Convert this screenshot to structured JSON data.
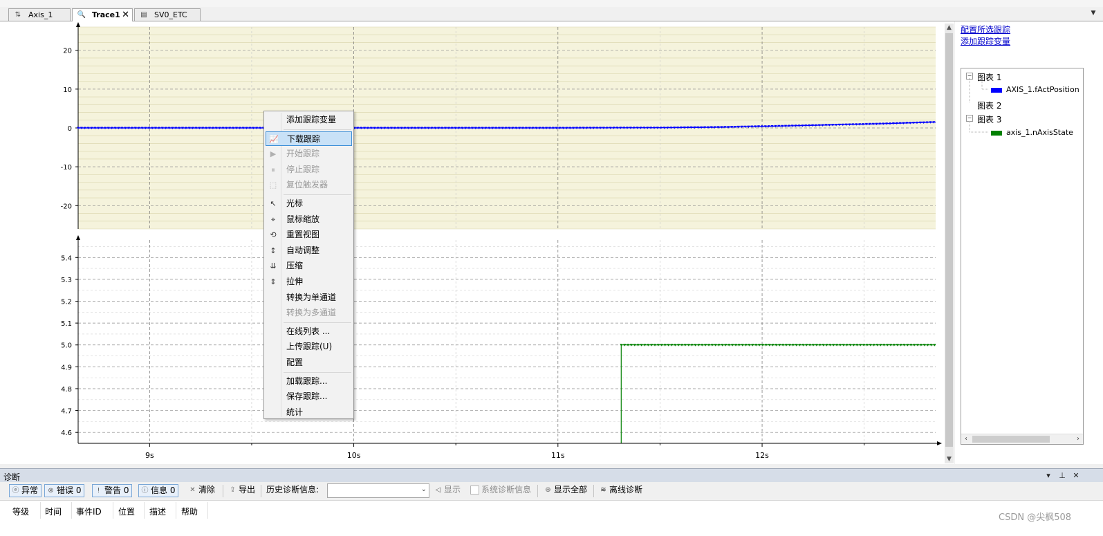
{
  "tabs": [
    {
      "label": "Axis_1",
      "icon": "axis-icon",
      "active": false
    },
    {
      "label": "Trace1",
      "icon": "trace-icon",
      "active": true,
      "closable": true
    },
    {
      "label": "SV0_ETC",
      "icon": "document-icon",
      "active": false
    }
  ],
  "right_panel": {
    "links": [
      "配置所选跟踪",
      "添加跟踪变量"
    ],
    "tree": [
      {
        "label": "图表 1",
        "expanded": true,
        "children": [
          {
            "label": "AXIS_1.fActPosition",
            "color": "#0000ff"
          }
        ]
      },
      {
        "label": "图表 2",
        "expanded": false,
        "children": []
      },
      {
        "label": "图表 3",
        "expanded": true,
        "children": [
          {
            "label": "axis_1.nAxisState",
            "color": "#008000"
          }
        ]
      }
    ]
  },
  "chart_data": [
    {
      "type": "line",
      "background": "#f5f3dc",
      "grid": true,
      "xlim": [
        8.65,
        12.85
      ],
      "ylim": [
        -26,
        26
      ],
      "yticks": [
        20,
        10,
        0,
        -10,
        -20
      ],
      "series": [
        {
          "color": "#0000ff",
          "x": [
            8.65,
            9.0,
            9.5,
            10.0,
            10.5,
            11.0,
            11.5,
            11.8,
            12.0,
            12.2,
            12.4,
            12.6,
            12.85
          ],
          "y": [
            0.0,
            0.0,
            0.0,
            0.0,
            0.0,
            0.0,
            0.05,
            0.2,
            0.4,
            0.6,
            0.85,
            1.1,
            1.5
          ]
        }
      ]
    },
    {
      "type": "line",
      "background": "#ffffff",
      "grid": true,
      "xlim": [
        8.65,
        12.85
      ],
      "ylim": [
        4.55,
        5.48
      ],
      "yticks": [
        5.4,
        5.3,
        5.2,
        5.1,
        5.0,
        4.9,
        4.8,
        4.7,
        4.6
      ],
      "xticks": [
        9,
        10,
        11,
        12
      ],
      "xticklabels": [
        "9s",
        "10s",
        "11s",
        "12s"
      ],
      "series": [
        {
          "color": "#008000",
          "x": [
            11.31,
            11.31,
            12.85
          ],
          "y": [
            4.55,
            5.0,
            5.0
          ]
        }
      ]
    }
  ],
  "context_menu": {
    "items": [
      {
        "label": "添加跟踪变量",
        "icon": "",
        "disabled": false,
        "highlighted": false
      },
      {
        "separator": true
      },
      {
        "label": "下载跟踪",
        "icon": "download-trace-icon",
        "disabled": false,
        "highlighted": true
      },
      {
        "label": "开始跟踪",
        "icon": "play-icon",
        "disabled": true
      },
      {
        "label": "停止跟踪",
        "icon": "pause-icon",
        "disabled": true
      },
      {
        "label": "复位触发器",
        "icon": "reset-trigger-icon",
        "disabled": true
      },
      {
        "separator": true
      },
      {
        "label": "光标",
        "icon": "cursor-icon",
        "disabled": false
      },
      {
        "label": "鼠标缩放",
        "icon": "mouse-zoom-icon",
        "disabled": false
      },
      {
        "label": "重置视图",
        "icon": "reset-view-icon",
        "disabled": false
      },
      {
        "label": "自动调整",
        "icon": "auto-fit-icon",
        "disabled": false
      },
      {
        "label": "压缩",
        "icon": "compress-icon",
        "disabled": false
      },
      {
        "label": "拉伸",
        "icon": "stretch-icon",
        "disabled": false
      },
      {
        "label": "转换为单通道",
        "icon": "",
        "disabled": false
      },
      {
        "label": "转换为多通道",
        "icon": "",
        "disabled": true
      },
      {
        "separator": true
      },
      {
        "label": "在线列表 ...",
        "icon": "",
        "disabled": false
      },
      {
        "label": "上传跟踪(U)",
        "icon": "",
        "disabled": false
      },
      {
        "label": "配置",
        "icon": "",
        "disabled": false
      },
      {
        "separator": true
      },
      {
        "label": "加载跟踪...",
        "icon": "",
        "disabled": false
      },
      {
        "label": "保存跟踪...",
        "icon": "",
        "disabled": false
      },
      {
        "label": "统计",
        "icon": "",
        "disabled": false
      }
    ]
  },
  "diagnostics": {
    "title": "诊断",
    "toolbar": {
      "exception": "异常",
      "errors": "错误 0",
      "warnings": "警告 0",
      "info": "信息 0",
      "clear": "清除",
      "export": "导出",
      "history_label": "历史诊断信息:",
      "history_value": "",
      "show": "显示",
      "system_diag": "系统诊断信息",
      "show_all": "显示全部",
      "offline_diag": "离线诊断"
    },
    "columns": [
      "等级",
      "时间",
      "事件ID",
      "位置",
      "描述",
      "帮助"
    ]
  },
  "watermark": "CSDN @尖枫508"
}
